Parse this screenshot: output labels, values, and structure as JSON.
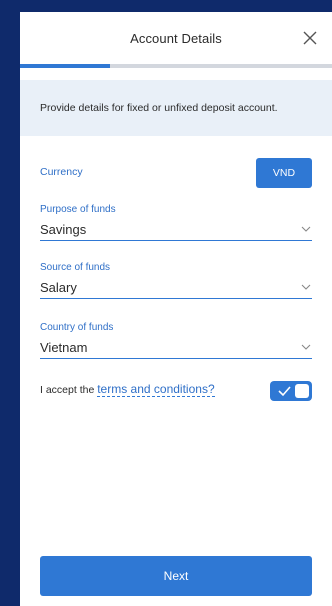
{
  "header": {
    "title": "Account Details",
    "close_icon": "close-icon"
  },
  "progress": {
    "fraction": 0.29
  },
  "banner": {
    "text": "Provide details for fixed or unfixed deposit account."
  },
  "currency": {
    "label": "Currency",
    "value": "VND"
  },
  "fields": [
    {
      "label": "Purpose of funds",
      "value": "Savings",
      "icon": "chevron-down-icon"
    },
    {
      "label": "Source of funds",
      "value": "Salary",
      "icon": "chevron-down-icon"
    },
    {
      "label": "Country of funds",
      "value": "Vietnam",
      "icon": "chevron-down-icon"
    }
  ],
  "terms": {
    "prefix": "I accept the",
    "link": "terms and conditions?",
    "accepted": true
  },
  "footer": {
    "next_label": "Next"
  },
  "colors": {
    "accent": "#2f78d4",
    "label": "#2f6fc7",
    "background": "#0f2a6b",
    "banner": "#e9f0f8"
  }
}
